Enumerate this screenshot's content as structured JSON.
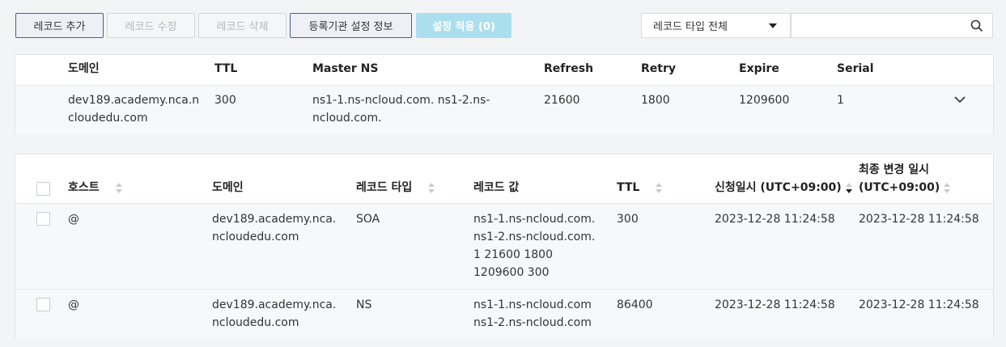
{
  "toolbar": {
    "add": "레코드 추가",
    "edit": "레코드 수정",
    "delete": "레코드 삭제",
    "registrar": "등록기관 설정 정보",
    "apply": "설정 적용 (0)"
  },
  "filter": {
    "record_type": "레코드 타입 전체",
    "search_placeholder": ""
  },
  "domain_table": {
    "headers": [
      "도메인",
      "TTL",
      "Master NS",
      "Refresh",
      "Retry",
      "Expire",
      "Serial"
    ],
    "row": {
      "domain_1": "dev189.academy.nca.n",
      "domain_2": "cloudedu.com",
      "ttl": "300",
      "master_ns_1": "ns1-1.ns-ncloud.com. ns1-2.ns-",
      "master_ns_2": "ncloud.com.",
      "refresh": "21600",
      "retry": "1800",
      "expire": "1209600",
      "serial": "1"
    }
  },
  "record_table": {
    "headers": {
      "host": "호스트",
      "domain": "도메인",
      "type": "레코드 타입",
      "value": "레코드 값",
      "ttl": "TTL",
      "requested": "신청일시 (UTC+09:00)",
      "modified_1": "최종 변경 일시",
      "modified_2": "(UTC+09:00)"
    },
    "rows": [
      {
        "host": "@",
        "domain_1": "dev189.academy.nca.",
        "domain_2": "ncloudedu.com",
        "type": "SOA",
        "value_1": "ns1-1.ns-ncloud.com.",
        "value_2": "ns1-2.ns-ncloud.com.",
        "value_3": "1 21600 1800",
        "value_4": "1209600 300",
        "ttl": "300",
        "requested": "2023-12-28 11:24:58",
        "modified": "2023-12-28 11:24:58"
      },
      {
        "host": "@",
        "domain_1": "dev189.academy.nca.",
        "domain_2": "ncloudedu.com",
        "type": "NS",
        "value_1": "ns1-1.ns-ncloud.com",
        "value_2": "ns1-2.ns-ncloud.com",
        "ttl": "86400",
        "requested": "2023-12-28 11:24:58",
        "modified": "2023-12-28 11:24:58"
      }
    ]
  }
}
